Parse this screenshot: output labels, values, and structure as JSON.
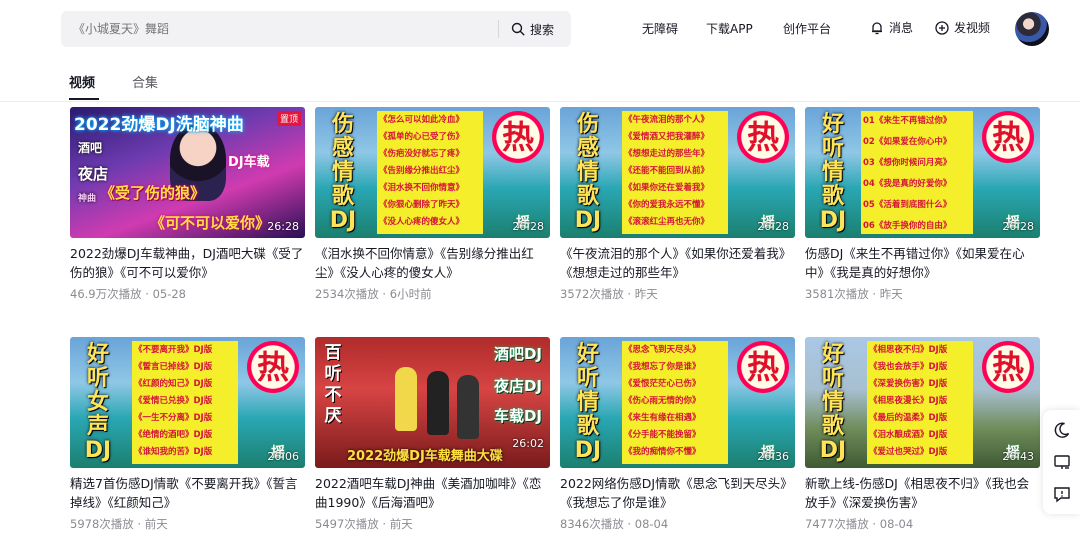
{
  "search": {
    "placeholder": "《小城夏天》舞蹈",
    "button_label": "搜索"
  },
  "header": {
    "links": [
      "无障碍",
      "下载APP",
      "创作平台"
    ],
    "messages_label": "消息",
    "upload_label": "发视频"
  },
  "tabs": [
    {
      "label": "视频",
      "active": true
    },
    {
      "label": "合集",
      "active": false
    }
  ],
  "videos": [
    {
      "title": "2022劲爆DJ车载神曲，DJ酒吧大碟《受了伤的狼》《可不可以爱你》",
      "views": "46.9万次播放",
      "time": "05-28",
      "duration": "26:28",
      "cover": {
        "headline": "2022劲爆DJ洗脑神曲",
        "badge": "置顶",
        "left1": "酒吧",
        "left2": "夜店",
        "left3": "神曲",
        "right1": "DJ车载",
        "big1": "《受了伤的狼》",
        "big2": "《可不可以爱你》"
      }
    },
    {
      "title": "《泪水换不回你情意》《告别缘分推出红尘》《没人心疼的傻女人》",
      "views": "2534次播放",
      "time": "6小时前",
      "duration": "26:28",
      "cover": {
        "vertical": "伤感情歌DJ",
        "hot": "热",
        "lines": [
          "《怎么可以如此冷血》",
          "《孤单的心已受了伤》",
          "《伤疤没好就忘了疼》",
          "《告别缘分推出红尘》",
          "《泪水换不回你情意》",
          "《你狠心删除了昨天》",
          "《没人心疼的傻女人》"
        ]
      }
    },
    {
      "title": "《午夜流泪的那个人》《如果你还爱着我》《想想走过的那些年》",
      "views": "3572次播放",
      "time": "昨天",
      "duration": "26:28",
      "cover": {
        "vertical": "伤感情歌DJ",
        "hot": "热",
        "lines": [
          "《午夜流泪的那个人》",
          "《爱情酒又把我灌醉》",
          "《想想走过的那些年》",
          "《还能不能回到从前》",
          "《如果你还在爱着我》",
          "《你的爱我永远不懂》",
          "《滚滚红尘再也无你》"
        ]
      }
    },
    {
      "title": "伤感DJ《来生不再错过你》《如果爱在心中》《我是真的好想你》",
      "views": "3581次播放",
      "time": "昨天",
      "duration": "26:28",
      "cover": {
        "vertical": "好听情歌DJ",
        "hot": "热",
        "lines": [
          "01《来生不再错过你》",
          "02《如果爱在你心中》",
          "03《想你时候问月亮》",
          "04《我是真的好爱你》",
          "05《活着到底图什么》",
          "06《放手换你的自由》"
        ]
      }
    },
    {
      "title": "精选7首伤感DJ情歌《不要离开我》《誓言掉线》《红颜知己》",
      "views": "5978次播放",
      "time": "前天",
      "duration": "26:06",
      "cover": {
        "vertical": "好听女声DJ",
        "hot": "热",
        "lines": [
          "《不要离开我》DJ版",
          "《誓言已掉线》DJ版",
          "《红颜的知己》DJ版",
          "《爱情已兑换》DJ版",
          "《一生不分离》DJ版",
          "《绝情的酒吧》DJ版",
          "《谁知我的苦》DJ版"
        ]
      }
    },
    {
      "title": "2022酒吧车载DJ神曲《美酒加咖啡》《恋曲1990》《后海酒吧》",
      "views": "5497次播放",
      "time": "前天",
      "duration": "26:02",
      "cover": {
        "vertical": "百听不厌",
        "right1": "酒吧DJ",
        "right2": "夜店DJ",
        "right3": "车载DJ",
        "bottom": "2022劲爆DJ车载舞曲大碟"
      }
    },
    {
      "title": "2022网络伤感DJ情歌《思念飞到天尽头》《我想忘了你是谁》",
      "views": "8346次播放",
      "time": "08-04",
      "duration": "26:36",
      "cover": {
        "vertical": "好听情歌DJ",
        "hot": "热",
        "lines": [
          "《思念飞到天尽头》",
          "《我想忘了你是谁》",
          "《爱恨茫茫心已伤》",
          "《伤心雨无情的你》",
          "《来生有缘在相遇》",
          "《分手能不能挽留》",
          "《我的痴情你不懂》"
        ]
      }
    },
    {
      "title": "新歌上线-伤感DJ《相思夜不归》《我也会放手》《深爱换伤害》",
      "views": "7477次播放",
      "time": "08-04",
      "duration": "26:43",
      "cover": {
        "vertical": "好听情歌DJ",
        "hot": "热",
        "lines": [
          "《相思夜不归》DJ版",
          "《我也会放手》DJ版",
          "《深爱换伤害》DJ版",
          "《相思夜漫长》DJ版",
          "《最后的温柔》DJ版",
          "《泪水酿成酒》DJ版",
          "《爱过也哭过》DJ版"
        ]
      }
    }
  ],
  "meta_separator": " · ",
  "sticker": "摇"
}
